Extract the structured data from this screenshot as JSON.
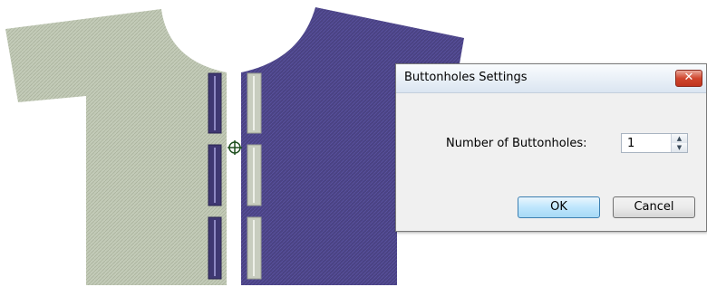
{
  "canvas": {
    "garment_left_color": "#c3cbb8",
    "garment_right_color": "#4a4283",
    "buttonhole_left_color": "#3f3872",
    "buttonhole_right_color": "#c8cdbf",
    "cursor_icon": "crosshair-move-cursor-icon"
  },
  "dialog": {
    "title": "Buttonholes Settings",
    "close_label": "✕",
    "field_label": "Number of Buttonholes:",
    "field_value": "1",
    "ok_label": "OK",
    "cancel_label": "Cancel"
  }
}
